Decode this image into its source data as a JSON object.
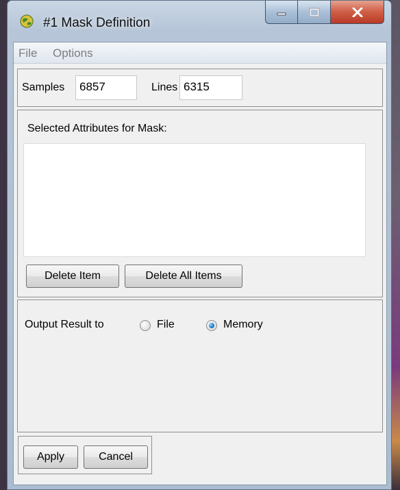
{
  "window": {
    "title": "#1 Mask Definition",
    "icon": "globe-icon",
    "controls": {
      "minimize": "minimize-icon",
      "maximize": "maximize-icon",
      "close": "close-icon"
    }
  },
  "menubar": {
    "items": [
      "File",
      "Options"
    ]
  },
  "dimensions": {
    "samples_label": "Samples",
    "samples_value": "6857",
    "lines_label": "Lines",
    "lines_value": "6315"
  },
  "attributes": {
    "label": "Selected Attributes for Mask:",
    "items": [],
    "delete_item_label": "Delete Item",
    "delete_all_label": "Delete All Items"
  },
  "output": {
    "label": "Output Result to",
    "options": [
      "File",
      "Memory"
    ],
    "selected": "Memory"
  },
  "footer": {
    "apply_label": "Apply",
    "cancel_label": "Cancel"
  },
  "colors": {
    "radio_selected": "#1f7fd0",
    "close_button": "#c8452f"
  }
}
